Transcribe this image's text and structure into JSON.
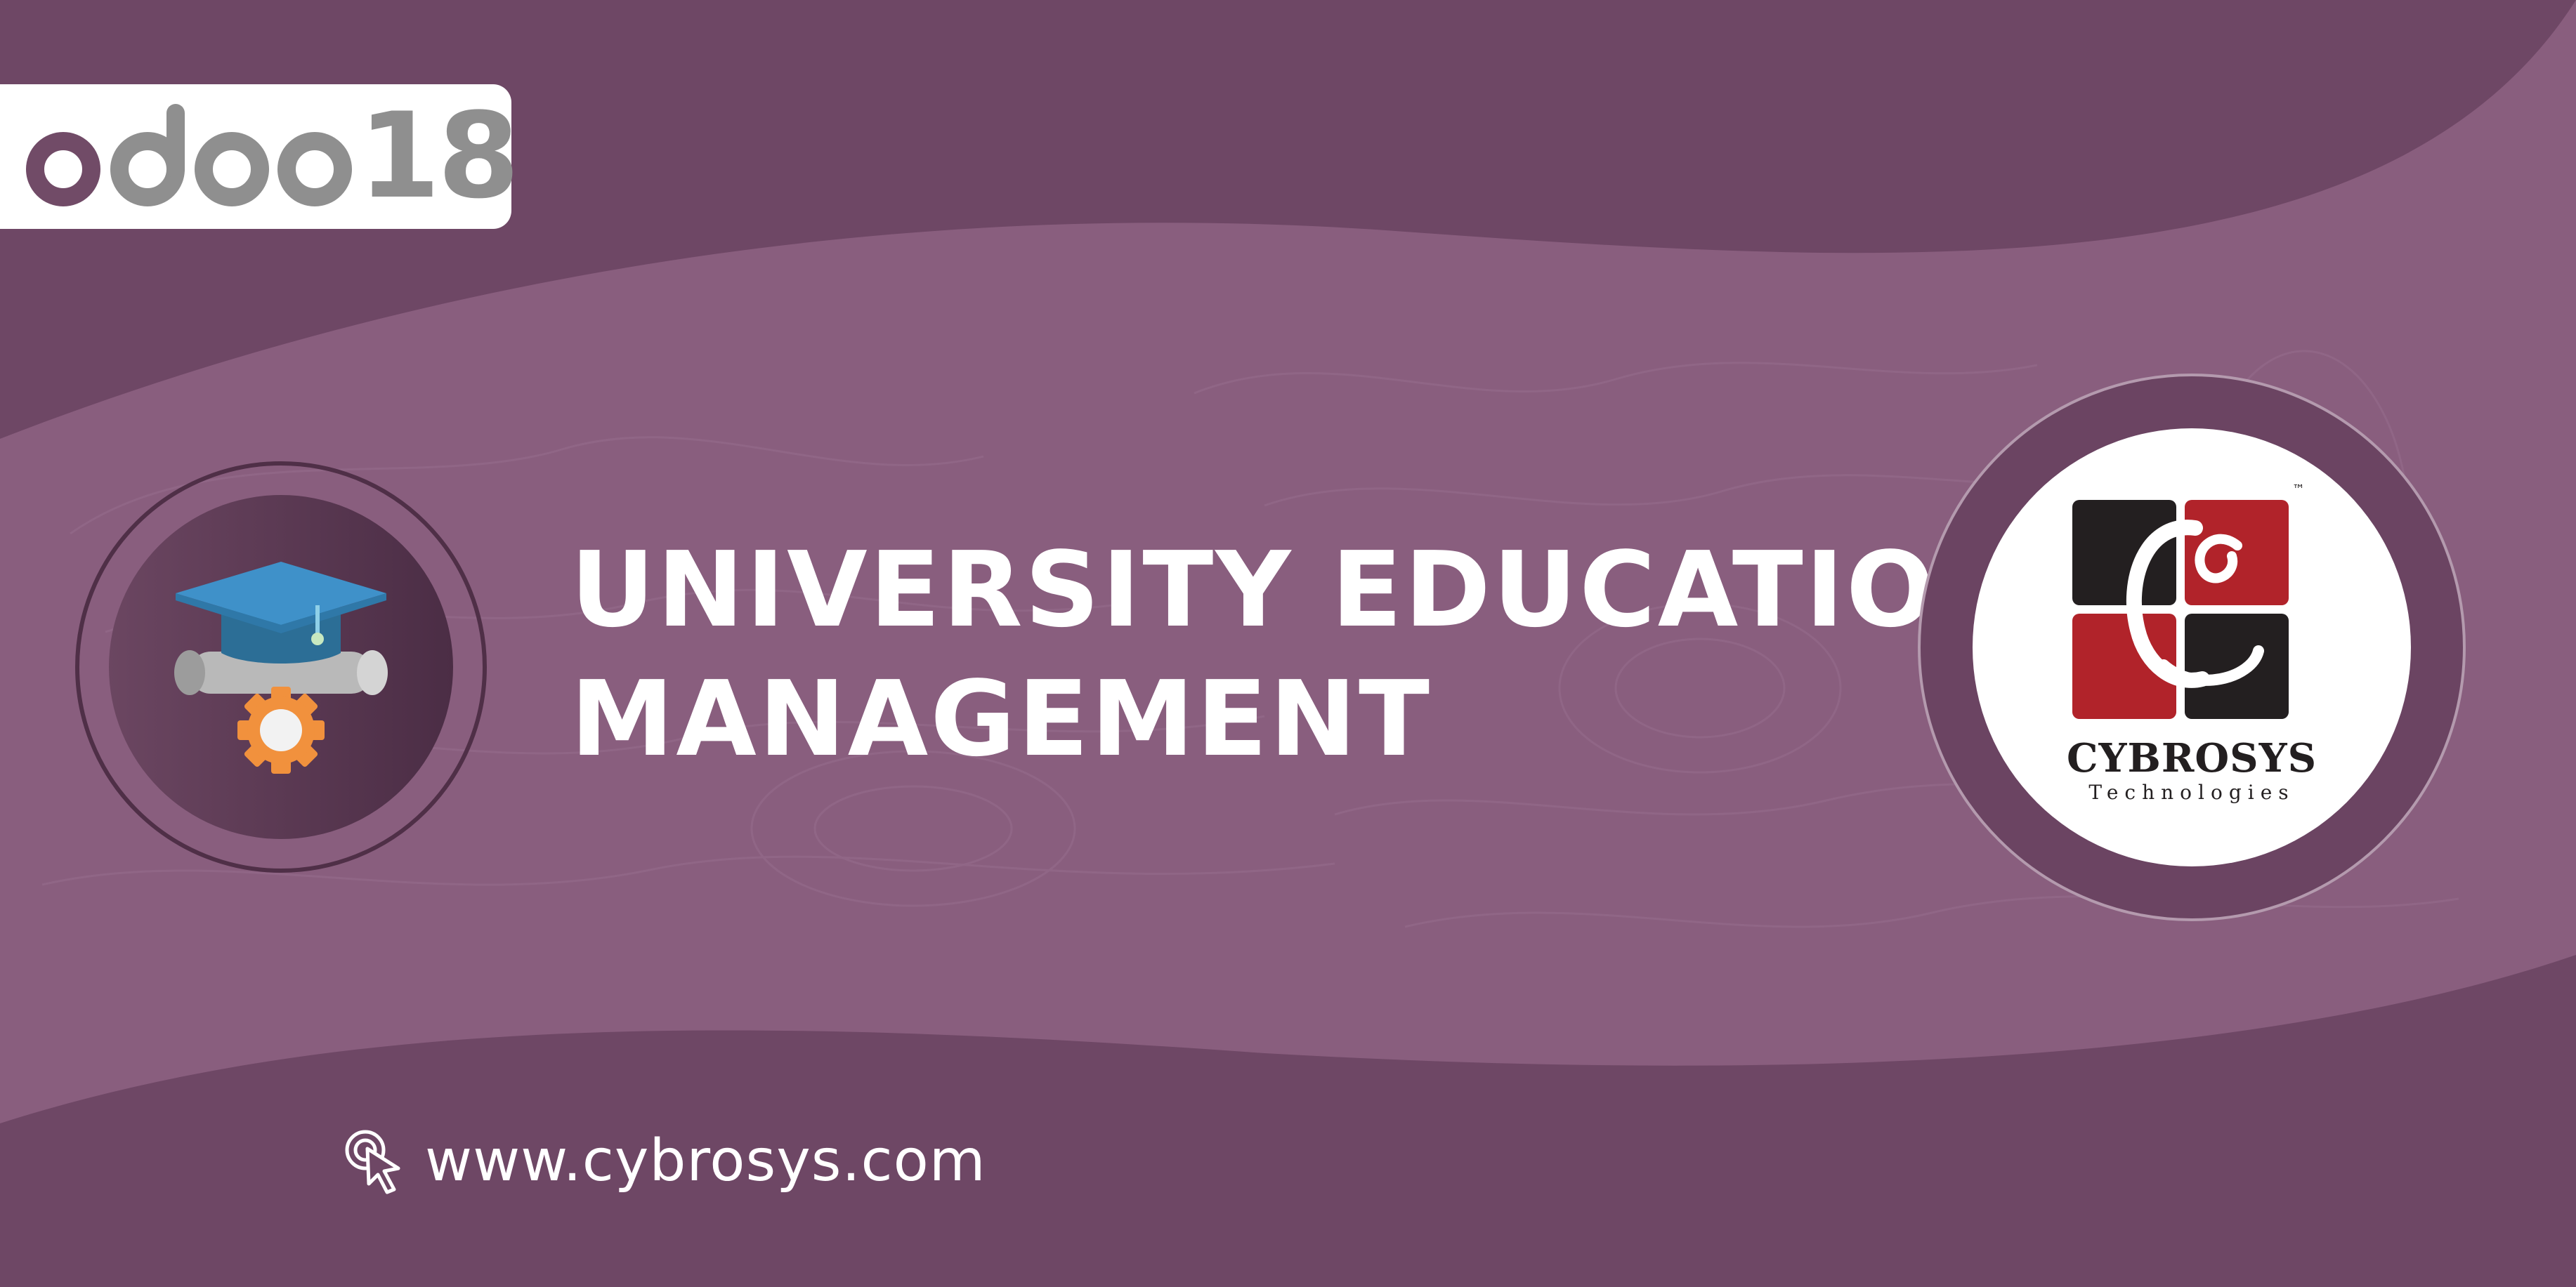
{
  "brand": {
    "product": "odoo",
    "version": "18",
    "colors": {
      "background": "#6e4765",
      "band": "#895e7e",
      "odoo_purple": "#714b67",
      "odoo_gray": "#8f8f8f"
    }
  },
  "module": {
    "title_line1": "UNIVERSITY EDUCATION",
    "title_line2": "MANAGEMENT",
    "icon": "graduation-cap-gear-icon"
  },
  "company": {
    "name": "CYBROSYS",
    "tagline": "Technologies",
    "trademark": "™",
    "logo_colors": {
      "dark": "#231f20",
      "red": "#b1232a"
    }
  },
  "footer": {
    "url": "www.cybrosys.com",
    "icon": "cursor-click-icon"
  }
}
